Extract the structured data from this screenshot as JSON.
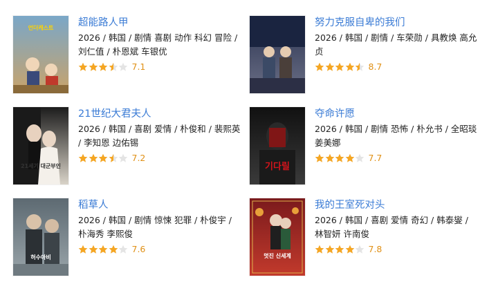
{
  "colors": {
    "title": "#3a7bd5",
    "star": "#f5a623",
    "star_empty": "#e4e4e4",
    "score": "#e09015"
  },
  "items": [
    {
      "title": "超能路人甲",
      "meta": "2026 / 韩国 / 剧情 喜剧 动作 科幻 冒险 / 刘仁值 / 朴恩斌 车银优",
      "score": "7.1",
      "stars": 3.5,
      "poster": {
        "bg": [
          "#7aa7c8",
          "#c9a36a"
        ],
        "accent": "#e9c23a",
        "text": "언더캐스트",
        "text_color": "#ffd400"
      }
    },
    {
      "title": "努力克服自卑的我们",
      "meta": "2026 / 韩国 / 剧情 / 车荣勋 / 具教焕 高允贞",
      "score": "8.7",
      "stars": 4.5,
      "poster": {
        "bg": [
          "#2a3350",
          "#6b6f86"
        ],
        "accent": "#c94a4a",
        "text": "",
        "text_color": "#ffffff"
      }
    },
    {
      "title": "21世纪大君夫人",
      "meta": "2026 / 韩国 / 喜剧 爱情 / 朴俊和 / 裴熙英 / 李知恩 边佑锡",
      "score": "7.2",
      "stars": 3.5,
      "poster": {
        "bg": [
          "#1c1c1c",
          "#d9d3c8"
        ],
        "accent": "#f2eee6",
        "text": "21세기 대군부인",
        "text_color": "#333333"
      }
    },
    {
      "title": "夺命许愿",
      "meta": "2026 / 韩国 / 剧情 恐怖 / 朴允书 / 全昭琰 姜美娜",
      "score": "7.7",
      "stars": 4,
      "poster": {
        "bg": [
          "#111111",
          "#3a3a3a"
        ],
        "accent": "#b5121b",
        "text": "기다릴",
        "text_color": "#d4141c"
      }
    },
    {
      "title": "稻草人",
      "meta": "2026 / 韩国 / 剧情 惊悚 犯罪 / 朴俊宇 / 朴海秀 李熙俊",
      "score": "7.6",
      "stars": 4,
      "poster": {
        "bg": [
          "#5d6a72",
          "#9aa5aa"
        ],
        "accent": "#2b3034",
        "text": "허수아비",
        "text_color": "#ffffff"
      }
    },
    {
      "title": "我的王室死对头",
      "meta": "2026 / 韩国 / 喜剧 爱情 奇幻 / 韩泰燮 / 林智妍 许南俊",
      "score": "7.8",
      "stars": 4,
      "poster": {
        "bg": [
          "#7a1a1c",
          "#c23a2c"
        ],
        "accent": "#1f3a2a",
        "text": "멋진 신세계",
        "text_color": "#ffffff"
      }
    }
  ]
}
